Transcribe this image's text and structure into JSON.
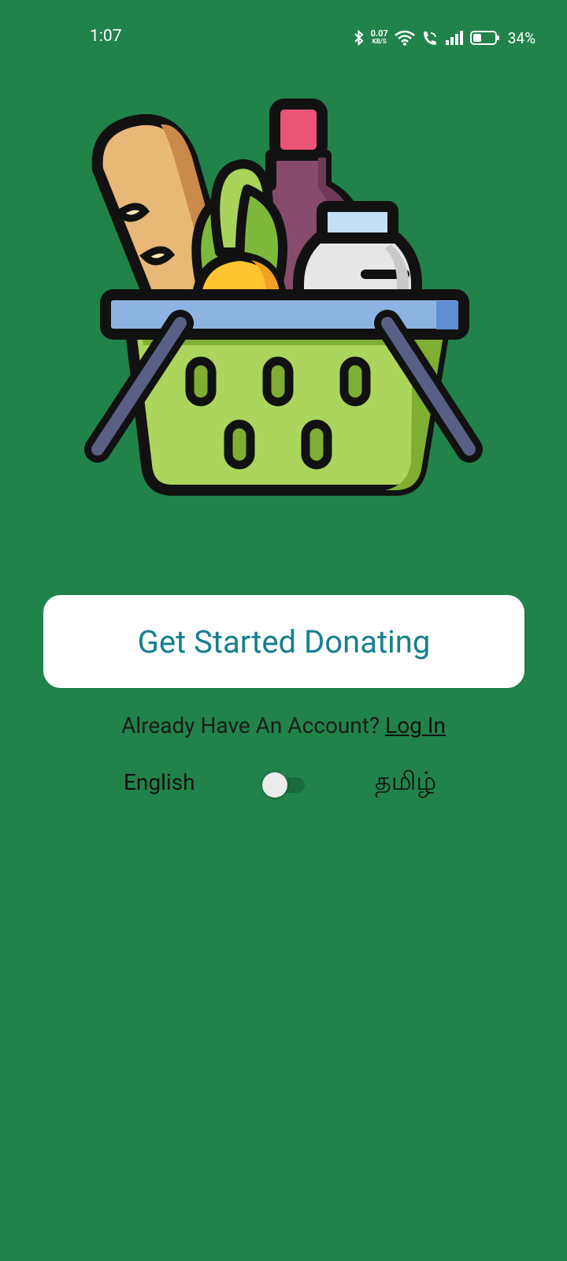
{
  "status_bar": {
    "time": "1:07",
    "net_speed_value": "0.07",
    "net_speed_unit": "KB/S",
    "battery_percent": "34%"
  },
  "hero": {
    "illustration": "grocery-basket-icon"
  },
  "cta": {
    "label": "Get Started Donating"
  },
  "login": {
    "prompt": "Already Have An Account?",
    "link_label": "Log In"
  },
  "language": {
    "left_label": "English",
    "right_label": "தமிழ்",
    "toggle_on": false
  },
  "colors": {
    "background": "#21834a",
    "button_text": "#167f8f",
    "button_bg": "#ffffff"
  }
}
